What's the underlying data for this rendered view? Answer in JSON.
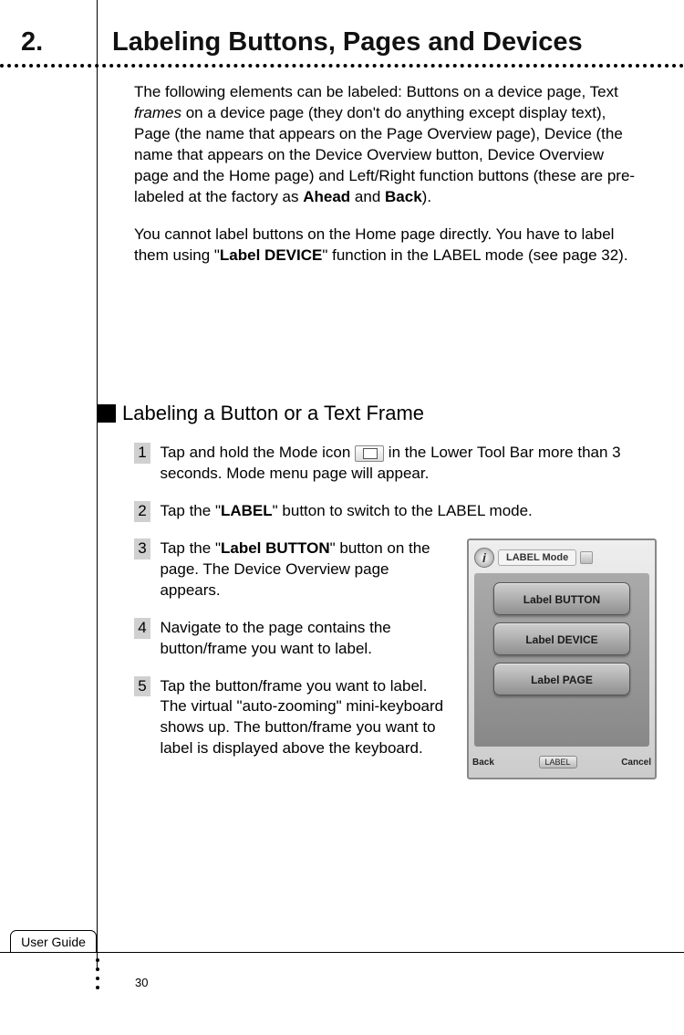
{
  "section": {
    "number": "2.",
    "title": "Labeling Buttons, Pages and Devices"
  },
  "intro": {
    "p1_a": "The following elements can be labeled: Buttons on a device page, Text ",
    "p1_frames": "frames",
    "p1_b": " on a device page (they don't do anything except display text), Page (the name that appears on the Page Overview page), Device (the name that appears on the Device Overview button, Device Overview page and the Home page) and Left/Right function buttons (these are pre-labeled at the factory as ",
    "p1_ahead": "Ahead",
    "p1_c": " and ",
    "p1_back": "Back",
    "p1_d": ").",
    "p2_a": "You cannot label buttons on the Home page directly. You have to label them using \"",
    "p2_bold": "Label DEVICE",
    "p2_b": "\" function in the LABEL mode (see page 32)."
  },
  "subsection": {
    "title": "Labeling a Button or a Text Frame"
  },
  "steps": {
    "s1_a": "Tap and hold the Mode icon ",
    "s1_b": " in the Lower Tool Bar more than 3 seconds. Mode menu page will appear.",
    "s2_a": "Tap the \"",
    "s2_bold": "LABEL",
    "s2_b": "\" button to switch to the LABEL mode.",
    "s3_a": "Tap the \"",
    "s3_bold": "Label BUTTON",
    "s3_b": "\" button on the page. The Device Overview page appears.",
    "s4": "Navigate to the page contains the button/frame you want to label.",
    "s5": "Tap the button/frame you want to label. The virtual \"auto-zooming\" mini-keyboard shows up. The button/frame you want to label is displayed above the keyboard.",
    "n1": "1",
    "n2": "2",
    "n3": "3",
    "n4": "4",
    "n5": "5"
  },
  "screenshot": {
    "top_tab": "LABEL Mode",
    "btn1": "Label BUTTON",
    "btn2": "Label DEVICE",
    "btn3": "Label PAGE",
    "back": "Back",
    "mid": "LABEL",
    "cancel": "Cancel"
  },
  "footer": {
    "tab": "User Guide",
    "page": "30"
  }
}
